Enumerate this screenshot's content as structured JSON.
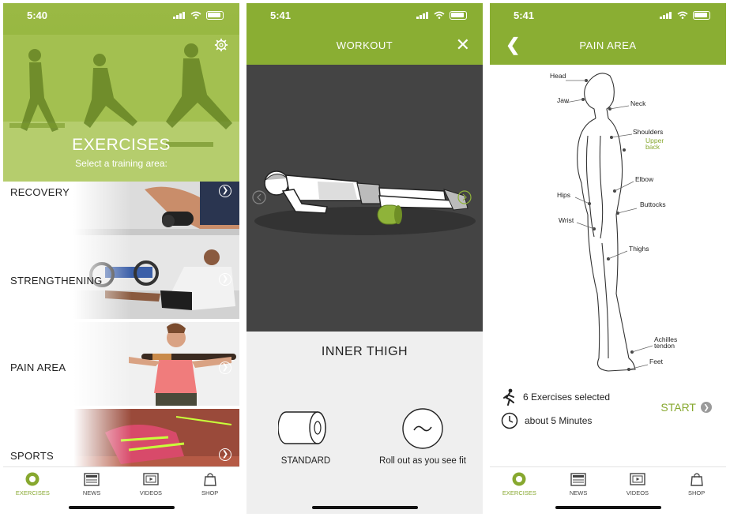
{
  "screens": [
    {
      "status_time": "5:40",
      "hero": {
        "title": "EXERCISES",
        "subtitle": "Select a training area:"
      },
      "categories": [
        {
          "label": "RECOVERY"
        },
        {
          "label": "STRENGTHENING"
        },
        {
          "label": "PAIN AREA"
        },
        {
          "label": "SPORTS"
        }
      ],
      "tabs": [
        {
          "label": "EXERCISES",
          "icon": "exercises-icon",
          "active": true
        },
        {
          "label": "NEWS",
          "icon": "news-icon"
        },
        {
          "label": "VIDEOS",
          "icon": "videos-icon"
        },
        {
          "label": "SHOP",
          "icon": "shop-icon"
        }
      ]
    },
    {
      "status_time": "5:41",
      "nav_title": "WORKOUT",
      "exercise_name": "INNER THIGH",
      "options": [
        {
          "label": "STANDARD",
          "icon": "foam-roller-icon"
        },
        {
          "label": "Roll out as you see fit",
          "icon": "wave-icon"
        }
      ]
    },
    {
      "status_time": "5:41",
      "nav_title": "PAIN AREA",
      "pain_labels": [
        "Head",
        "Jaw",
        "Neck",
        "Shoulders",
        "Upper back",
        "Elbow",
        "Hips",
        "Buttocks",
        "Wrist",
        "Thighs",
        "Achilles tendon",
        "Feet"
      ],
      "summary": {
        "exercises": "6 Exercises selected",
        "duration": "about 5 Minutes"
      },
      "start_label": "START",
      "tabs": [
        {
          "label": "EXERCISES",
          "icon": "exercises-icon",
          "active": true
        },
        {
          "label": "NEWS",
          "icon": "news-icon"
        },
        {
          "label": "VIDEOS",
          "icon": "videos-icon"
        },
        {
          "label": "SHOP",
          "icon": "shop-icon"
        }
      ]
    }
  ],
  "colors": {
    "accent": "#8aae33",
    "accent_text": "#87a82f",
    "stage_bg": "#444444",
    "panel_bg": "#efefef"
  }
}
